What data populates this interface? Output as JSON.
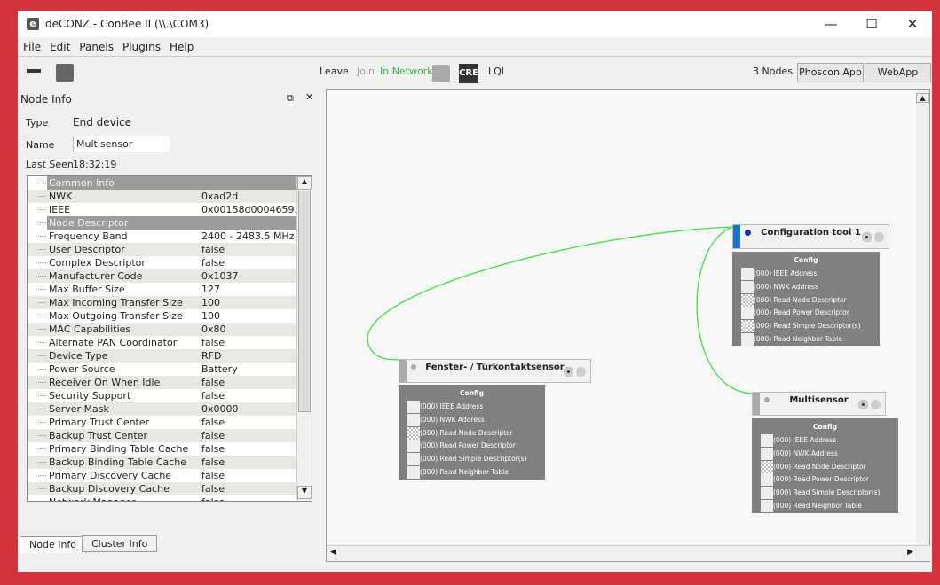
{
  "window": {
    "title": "deCONZ - ConBee II (\\\\.\\COM3)",
    "app_icon": "e",
    "minimize": "—",
    "maximize": "☐",
    "close": "✕"
  },
  "menu": [
    "File",
    "Edit",
    "Panels",
    "Plugins",
    "Help"
  ],
  "toolbar": {
    "leave": "Leave",
    "join": "Join",
    "status": "In Network",
    "status_color": "#3cb043",
    "cre": "CRE",
    "lqi": "LQI",
    "nodes": "3 Nodes",
    "phoscon": "Phoscon App",
    "webapp": "WebApp"
  },
  "panel": {
    "title": "Node Info",
    "type_label": "Type",
    "type_value": "End device",
    "name_label": "Name",
    "name_value": "Multisensor",
    "last_seen_label": "Last Seen",
    "last_seen_value": "18:32:19",
    "rows": [
      {
        "label": "Common Info",
        "header": true
      },
      {
        "label": "NWK",
        "value": "0xad2d"
      },
      {
        "label": "IEEE",
        "value": "0x00158d0004659..."
      },
      {
        "label": "Node Descriptor",
        "header": true
      },
      {
        "label": "Frequency Band",
        "value": "2400 - 2483.5 MHz"
      },
      {
        "label": "User Descriptor",
        "value": "false"
      },
      {
        "label": "Complex Descriptor",
        "value": "false"
      },
      {
        "label": "Manufacturer Code",
        "value": "0x1037"
      },
      {
        "label": "Max Buffer Size",
        "value": "127"
      },
      {
        "label": "Max Incoming Transfer Size",
        "value": "100"
      },
      {
        "label": "Max Outgoing Transfer Size",
        "value": "100"
      },
      {
        "label": "MAC Capabilities",
        "value": "0x80"
      },
      {
        "label": "Alternate PAN Coordinator",
        "value": "false"
      },
      {
        "label": "Device Type",
        "value": "RFD"
      },
      {
        "label": "Power Source",
        "value": "Battery"
      },
      {
        "label": "Receiver On When Idle",
        "value": "false"
      },
      {
        "label": "Security Support",
        "value": "false"
      },
      {
        "label": "Server Mask",
        "value": "0x0000"
      },
      {
        "label": "Primary Trust Center",
        "value": "false"
      },
      {
        "label": "Backup Trust Center",
        "value": "false"
      },
      {
        "label": "Primary Binding Table Cache",
        "value": "false"
      },
      {
        "label": "Backup Binding Table Cache",
        "value": "false"
      },
      {
        "label": "Primary Discovery Cache",
        "value": "false"
      },
      {
        "label": "Backup Discovery Cache",
        "value": "false"
      },
      {
        "label": "Network Manager",
        "value": "false"
      }
    ],
    "tabs": [
      "Node Info",
      "Cluster Info"
    ]
  },
  "nodes": [
    {
      "name": "Configuration tool 1",
      "bar_color": "#1a73c8",
      "config_title": "Config",
      "items": [
        "(000) IEEE Address",
        "(000) NWK Address",
        "(000) Read Node Descriptor",
        "(000) Read Power Descriptor",
        "(000) Read Simple Descriptor(s)",
        "(000) Read Neighbor Table"
      ],
      "checked": [
        false,
        false,
        true,
        false,
        true,
        false
      ]
    },
    {
      "name": "Fenster- / Türkontaktsensor",
      "bar_color": "#aaaaaa",
      "config_title": "Config",
      "items": [
        "(000) IEEE Address",
        "(000) NWK Address",
        "(000) Read Node Descriptor",
        "(000) Read Power Descriptor",
        "(000) Read Simple Descriptor(s)",
        "(000) Read Neighbor Table"
      ],
      "checked": [
        false,
        false,
        true,
        false,
        false,
        false
      ]
    },
    {
      "name": "Multisensor",
      "bar_color": "#aaaaaa",
      "config_title": "Config",
      "items": [
        "(000) IEEE Address",
        "(000) NWK Address",
        "(000) Read Node Descriptor",
        "(000) Read Power Descriptor",
        "(000) Read Simple Descriptor(s)",
        "(000) Read Neighbor Table"
      ],
      "checked": [
        false,
        false,
        true,
        false,
        false,
        false
      ]
    }
  ],
  "link_color": "#44dd44"
}
